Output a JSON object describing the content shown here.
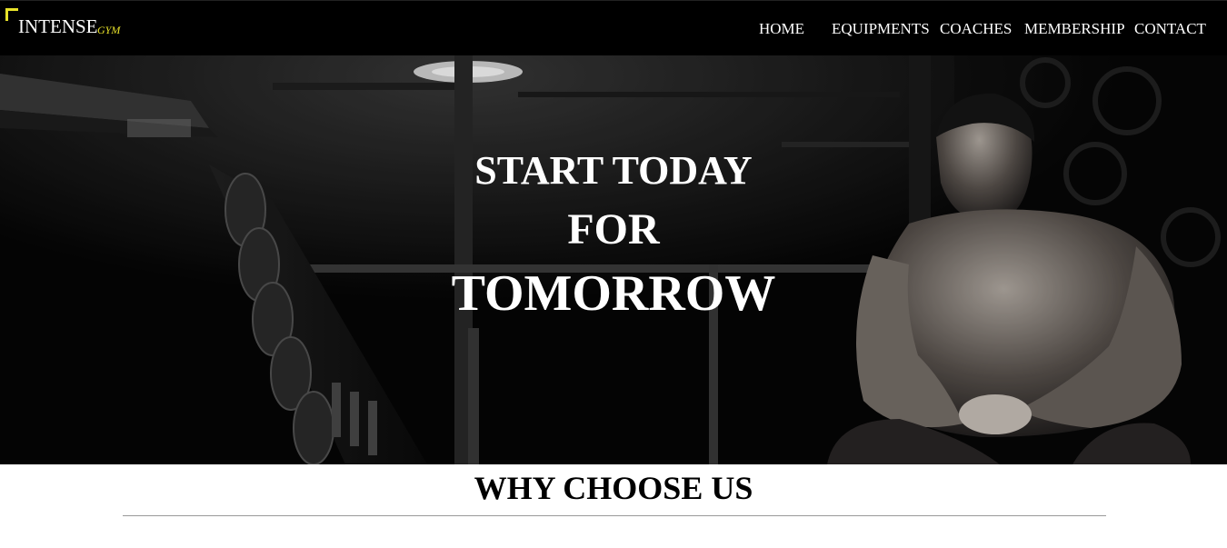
{
  "brand": {
    "name": "INTENSE",
    "tag": "GYM",
    "accent_color": "#e8e22a"
  },
  "nav": {
    "items": [
      {
        "label": "HOME"
      },
      {
        "label": "EQUIPMENTS"
      },
      {
        "label": "COACHES"
      },
      {
        "label": "MEMBERSHIP"
      },
      {
        "label": "CONTACT"
      }
    ]
  },
  "hero": {
    "line1": "START TODAY",
    "line2": "FOR",
    "line3": "TOMORROW",
    "image_subject": "gym-athlete-photo"
  },
  "section": {
    "title": "WHY CHOOSE US"
  }
}
